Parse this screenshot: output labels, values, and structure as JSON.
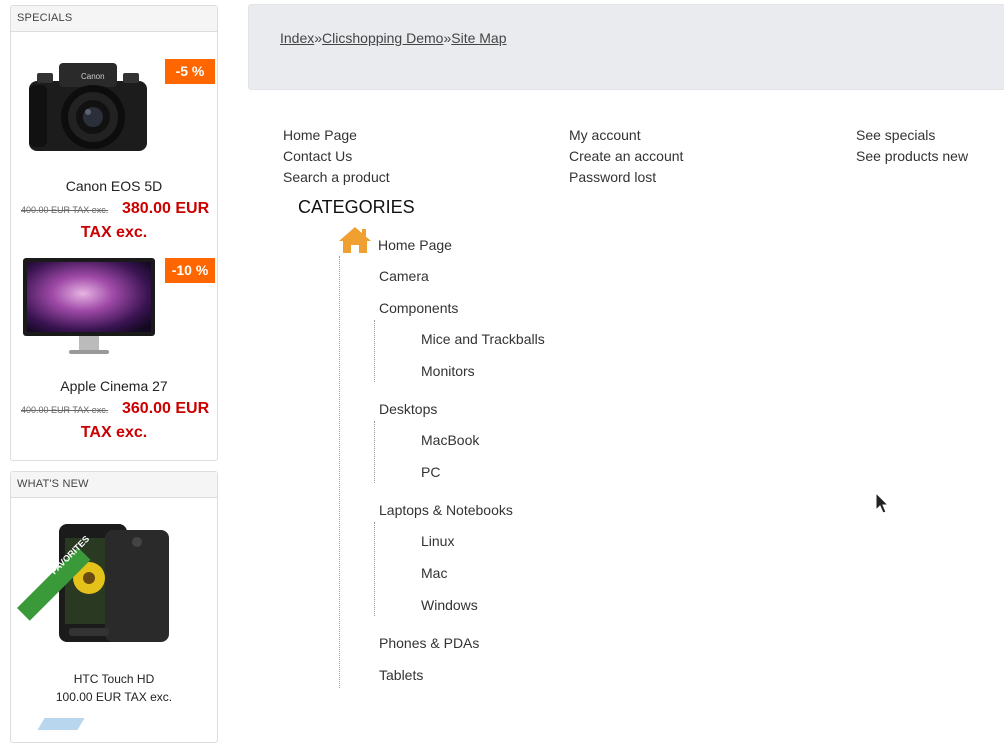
{
  "specials": {
    "header": "SPECIALS",
    "items": [
      {
        "badge": "-5 %",
        "name": "Canon EOS 5D",
        "old_price": "400.00 EUR TAX exc.",
        "new_price": "380.00 EUR",
        "tax": "TAX exc."
      },
      {
        "badge": "-10 %",
        "name": "Apple Cinema 27",
        "old_price": "400.00 EUR TAX exc.",
        "new_price": "360.00 EUR",
        "tax": "TAX exc."
      }
    ]
  },
  "whats_new": {
    "header": "WHAT'S NEW",
    "ribbon": "FAVORITES",
    "item": {
      "name": "HTC Touch HD",
      "price": "100.00 EUR TAX exc."
    }
  },
  "breadcrumb": {
    "items": [
      "Index",
      "Clicshopping Demo",
      "Site Map"
    ],
    "separator": "»"
  },
  "sitemap": {
    "col1": [
      "Home Page",
      "Contact Us",
      "Search a product"
    ],
    "col2": [
      "My account",
      "Create an account",
      "Password lost"
    ],
    "col3": [
      "See specials",
      "See products new"
    ]
  },
  "categories": {
    "title": "CATEGORIES",
    "home": "Home Page",
    "items": [
      "Camera",
      "Components",
      "Mice and Trackballs",
      "Monitors",
      "Desktops",
      "MacBook",
      "PC",
      "Laptops & Notebooks",
      "Linux",
      "Mac",
      "Windows",
      "Phones & PDAs",
      "Tablets"
    ]
  },
  "colors": {
    "accent": "#ff6600",
    "price": "#cc0000",
    "ribbon": "#3a9a3a",
    "home_icon": "#f0a030"
  }
}
